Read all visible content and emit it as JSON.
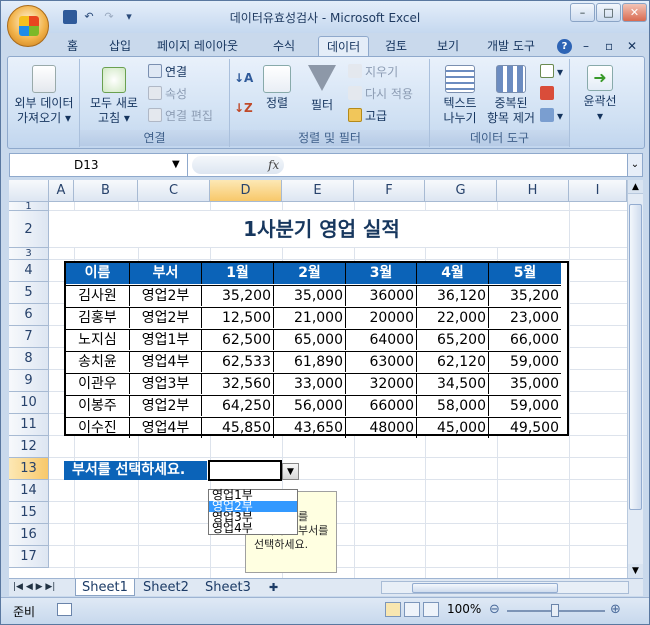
{
  "window": {
    "title": "데이터유효성검사 - Microsoft Excel"
  },
  "ribbon_tabs": [
    "홈",
    "삽입",
    "페이지 레이아웃",
    "수식",
    "데이터",
    "검토",
    "보기",
    "개발 도구"
  ],
  "active_tab": "데이터",
  "groups": {
    "get_external": {
      "label": "외부 데이터\n가져오기",
      "btn1": "외부 데이터",
      "btn2": "가져오기 ▾"
    },
    "connections": {
      "label": "연결",
      "refresh1": "모두 새로",
      "refresh2": "고침 ▾",
      "connect": "연결",
      "props": "속성",
      "edit_links": "연결 편집"
    },
    "sort_filter": {
      "label": "정렬 및 필터",
      "sort": "정렬",
      "filter": "필터",
      "clear": "지우기",
      "reapply": "다시 적용",
      "advanced": "고급"
    },
    "data_tools": {
      "label": "데이터 도구",
      "text_col1": "텍스트",
      "text_col2": "나누기",
      "dup1": "중복된",
      "dup2": "항목 제거"
    },
    "outline": {
      "label": "윤곽선",
      "btn": "윤곽선"
    }
  },
  "formula_bar": {
    "name_box": "D13",
    "fx": "fx",
    "formula": ""
  },
  "columns": [
    "A",
    "B",
    "C",
    "D",
    "E",
    "F",
    "G",
    "H",
    "I"
  ],
  "selected_column": "D",
  "rows": [
    "1",
    "2",
    "3",
    "4",
    "5",
    "6",
    "7",
    "8",
    "9",
    "10",
    "11",
    "12",
    "13",
    "14",
    "15",
    "16",
    "17"
  ],
  "selected_row": "13",
  "sheet_title": "1사분기 영업 실적",
  "table": {
    "headers": [
      "이름",
      "부서",
      "1월",
      "2월",
      "3월",
      "4월",
      "5월"
    ],
    "rows": [
      [
        "김사원",
        "영업2부",
        "35,200",
        "35,000",
        "36000",
        "36,120",
        "35,200"
      ],
      [
        "김홍부",
        "영업2부",
        "12,500",
        "21,000",
        "20000",
        "22,000",
        "23,000"
      ],
      [
        "노지심",
        "영업1부",
        "62,500",
        "65,000",
        "64000",
        "65,200",
        "66,000"
      ],
      [
        "송치윤",
        "영업4부",
        "62,533",
        "61,890",
        "63000",
        "62,120",
        "59,000"
      ],
      [
        "이관우",
        "영업3부",
        "32,560",
        "33,000",
        "32000",
        "34,500",
        "35,000"
      ],
      [
        "이봉주",
        "영업2부",
        "64,250",
        "56,000",
        "66000",
        "58,000",
        "59,000"
      ],
      [
        "이수진",
        "영업4부",
        "45,850",
        "43,650",
        "48000",
        "45,000",
        "49,500"
      ]
    ]
  },
  "prompt_label": "부서를 선택하세요.",
  "dropdown": {
    "options": [
      "영업1부",
      "영업2부",
      "영업3부",
      "영업4부"
    ],
    "highlighted": 1
  },
  "tooltip": [
    "부서 선택",
    "목록 단추를",
    "클릭하고 부서를",
    "선택하세요."
  ],
  "sheet_tabs": [
    "Sheet1",
    "Sheet2",
    "Sheet3"
  ],
  "active_sheet": "Sheet1",
  "status": {
    "mode": "준비",
    "zoom": "100%"
  },
  "colors": {
    "table_header": "#0b63b8",
    "prompt_fill": "#0b63b8",
    "title_text": "#17375e"
  }
}
